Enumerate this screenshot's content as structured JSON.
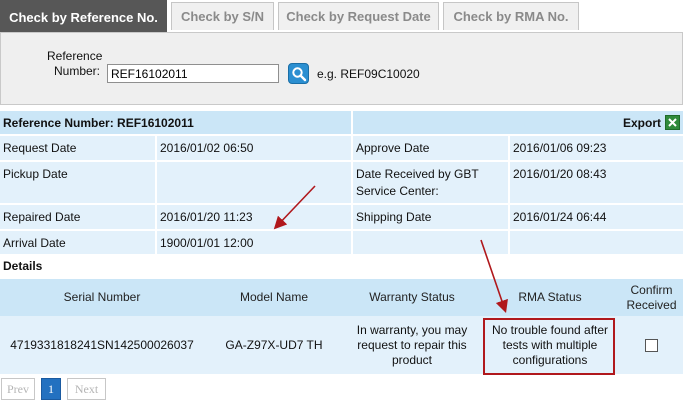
{
  "tabs": [
    {
      "label": "Check by Reference No.",
      "active": true
    },
    {
      "label": "Check by S/N",
      "active": false
    },
    {
      "label": "Check by Request Date",
      "active": false
    },
    {
      "label": "Check by RMA No.",
      "active": false
    }
  ],
  "search": {
    "label_line1": "Reference",
    "label_line2": "Number:",
    "value": "REF16102011",
    "example": "e.g. REF09C10020",
    "button_icon": "search-icon"
  },
  "info": {
    "header_title": "Reference Number: REF16102011",
    "export_label": "Export",
    "export_icon": "excel-icon",
    "rows": [
      {
        "left_label": "Request Date",
        "left_value": "2016/01/02 06:50",
        "right_label": "Approve Date",
        "right_value": "2016/01/06 09:23"
      },
      {
        "left_label": "Pickup Date",
        "left_value": "",
        "right_label": "Date Received by GBT Service Center:",
        "right_value": "2016/01/20 08:43"
      },
      {
        "left_label": "Repaired Date",
        "left_value": "2016/01/20 11:23",
        "right_label": "Shipping Date",
        "right_value": "2016/01/24 06:44"
      },
      {
        "left_label": "Arrival Date",
        "left_value": "1900/01/01 12:00",
        "right_label": "",
        "right_value": ""
      }
    ]
  },
  "details": {
    "label": "Details",
    "columns": [
      "Serial Number",
      "Model Name",
      "Warranty Status",
      "RMA Status",
      "Confirm Received"
    ],
    "rows": [
      {
        "serial": "4719331818241SN142500026037",
        "model": "GA-Z97X-UD7 TH",
        "warranty": "In warranty, you may request to repair this product",
        "rma": "No trouble found after tests with multiple configurations",
        "confirmed": false
      }
    ]
  },
  "pagination": {
    "prev": "Prev",
    "current": "1",
    "next": "Next"
  },
  "colors": {
    "accent": "#575757",
    "header_bg": "#cbe6f7",
    "row_bg": "#e3f1fb",
    "annotation": "#b0181c",
    "page_active": "#2371c0"
  }
}
